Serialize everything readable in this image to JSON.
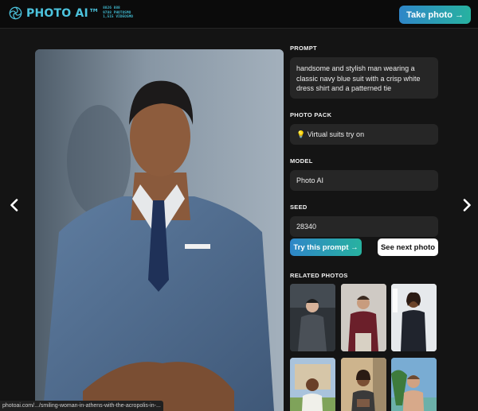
{
  "header": {
    "logo_text": "PHOTO AI™",
    "stats": [
      "8826 888",
      "9788 PHOTOSMO",
      "1,515 VIDEOSMO"
    ],
    "take_photo_label": "Take photo →",
    "accent": "#4cc3dd"
  },
  "nav": {
    "prev_icon": "chevron-left-icon",
    "next_icon": "chevron-right-icon"
  },
  "details": {
    "prompt_label": "PROMPT",
    "prompt_value": "handsome and stylish man wearing a classic navy blue suit with a crisp white dress shirt and a patterned tie",
    "pack_label": "PHOTO PACK",
    "pack_value": "💡 Virtual suits try on",
    "model_label": "MODEL",
    "model_value": "Photo AI",
    "seed_label": "SEED",
    "seed_value": "28340",
    "try_label": "Try this prompt →",
    "next_label": "See next photo",
    "related_label": "RELATED PHOTOS"
  },
  "status_url": "photoai.com/.../smiling-woman-in-athens-with-the-acropolis-in-..."
}
